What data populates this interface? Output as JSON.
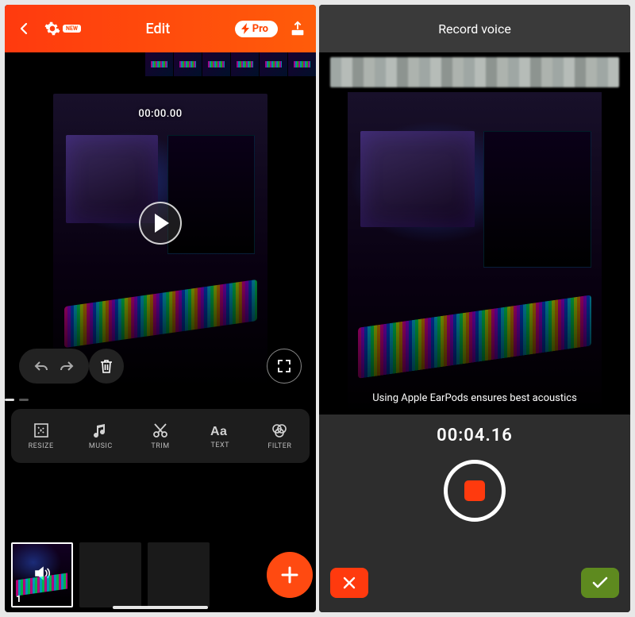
{
  "left": {
    "header": {
      "settings_badge": "NEW",
      "title": "Edit",
      "pro_label": "Pro"
    },
    "preview": {
      "timecode": "00:00.00"
    },
    "tools": {
      "resize": "RESIZE",
      "music": "MUSIC",
      "trim": "TRIM",
      "text": "TEXT",
      "filter": "FILTER"
    },
    "clips": {
      "first_index": "1"
    }
  },
  "right": {
    "header_title": "Record voice",
    "tip": "Using Apple EarPods ensures best acoustics",
    "timecode": "00:04.16"
  }
}
